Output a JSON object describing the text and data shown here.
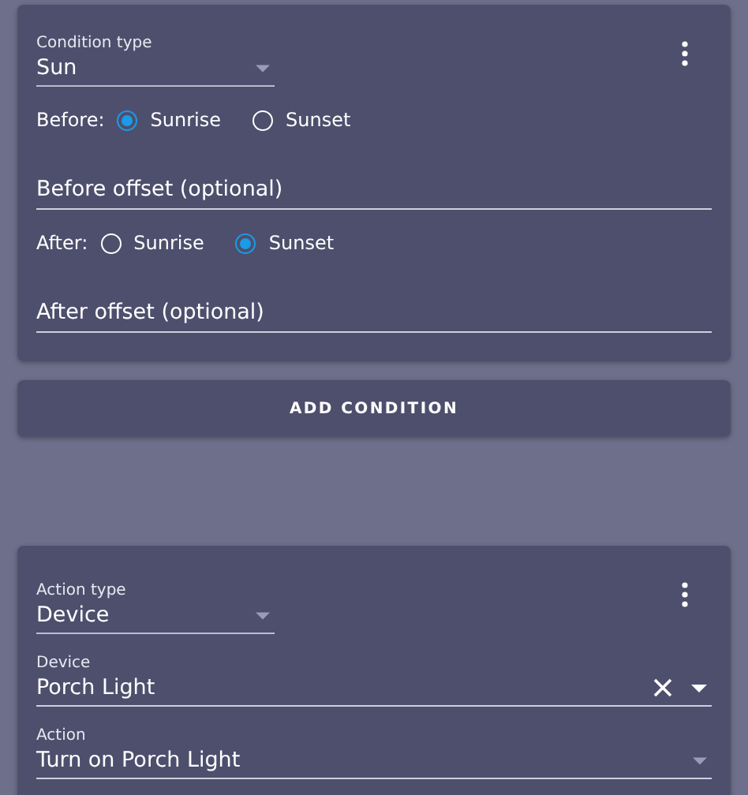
{
  "condition": {
    "type_field": {
      "label": "Condition type",
      "value": "Sun"
    },
    "before": {
      "label": "Before:",
      "options": [
        {
          "label": "Sunrise",
          "selected": true
        },
        {
          "label": "Sunset",
          "selected": false
        }
      ]
    },
    "before_offset": {
      "placeholder": "Before offset (optional)"
    },
    "after": {
      "label": "After:",
      "options": [
        {
          "label": "Sunrise",
          "selected": false
        },
        {
          "label": "Sunset",
          "selected": true
        }
      ]
    },
    "after_offset": {
      "placeholder": "After offset (optional)"
    }
  },
  "add_condition_button": "ADD CONDITION",
  "action": {
    "type_field": {
      "label": "Action type",
      "value": "Device"
    },
    "device_field": {
      "label": "Device",
      "value": "Porch Light"
    },
    "action_field": {
      "label": "Action",
      "value": "Turn on Porch Light"
    }
  }
}
